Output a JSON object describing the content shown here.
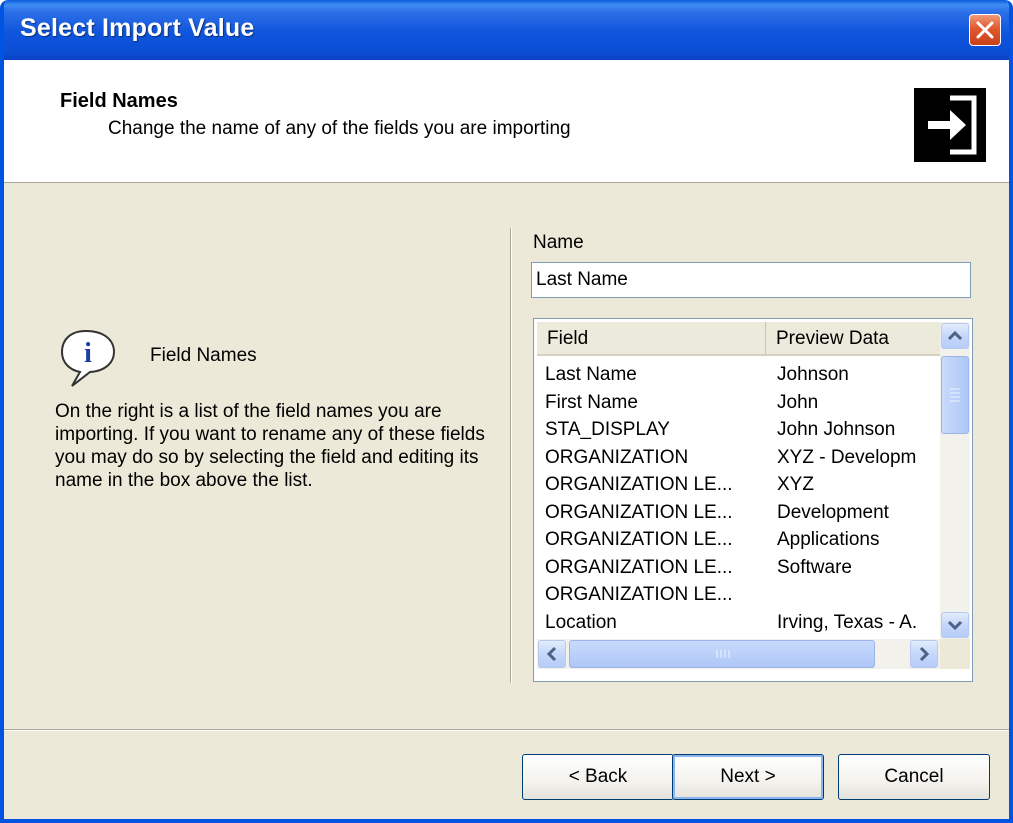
{
  "window": {
    "title": "Select Import Value"
  },
  "header": {
    "title": "Field Names",
    "subtitle": "Change the name of any of the fields you are importing",
    "icon": "import-arrow-icon"
  },
  "info": {
    "icon": "info-balloon-icon",
    "heading": "Field Names",
    "description": "On the right is a list of the field names you are importing. If you want to rename any of these fields you may do so by selecting the field and editing its name in the box above the list."
  },
  "name": {
    "label": "Name",
    "value": "Last Name"
  },
  "list": {
    "columns": [
      "Field",
      "Preview Data"
    ],
    "rows": [
      {
        "field": "Last Name",
        "preview": "Johnson"
      },
      {
        "field": "First Name",
        "preview": "John"
      },
      {
        "field": "STA_DISPLAY",
        "preview": "John Johnson"
      },
      {
        "field": "ORGANIZATION",
        "preview": "XYZ - Developm"
      },
      {
        "field": "ORGANIZATION LE...",
        "preview": "XYZ"
      },
      {
        "field": "ORGANIZATION LE...",
        "preview": "Development"
      },
      {
        "field": "ORGANIZATION LE...",
        "preview": "Applications"
      },
      {
        "field": "ORGANIZATION LE...",
        "preview": "Software"
      },
      {
        "field": "ORGANIZATION LE...",
        "preview": ""
      },
      {
        "field": "Location",
        "preview": "Irving, Texas - A."
      }
    ]
  },
  "buttons": {
    "back": "< Back",
    "next": "Next >",
    "cancel": "Cancel"
  },
  "colors": {
    "titlebar": "#0A50D8",
    "dialog_bg": "#ECE9D8",
    "close": "#E2582F"
  }
}
